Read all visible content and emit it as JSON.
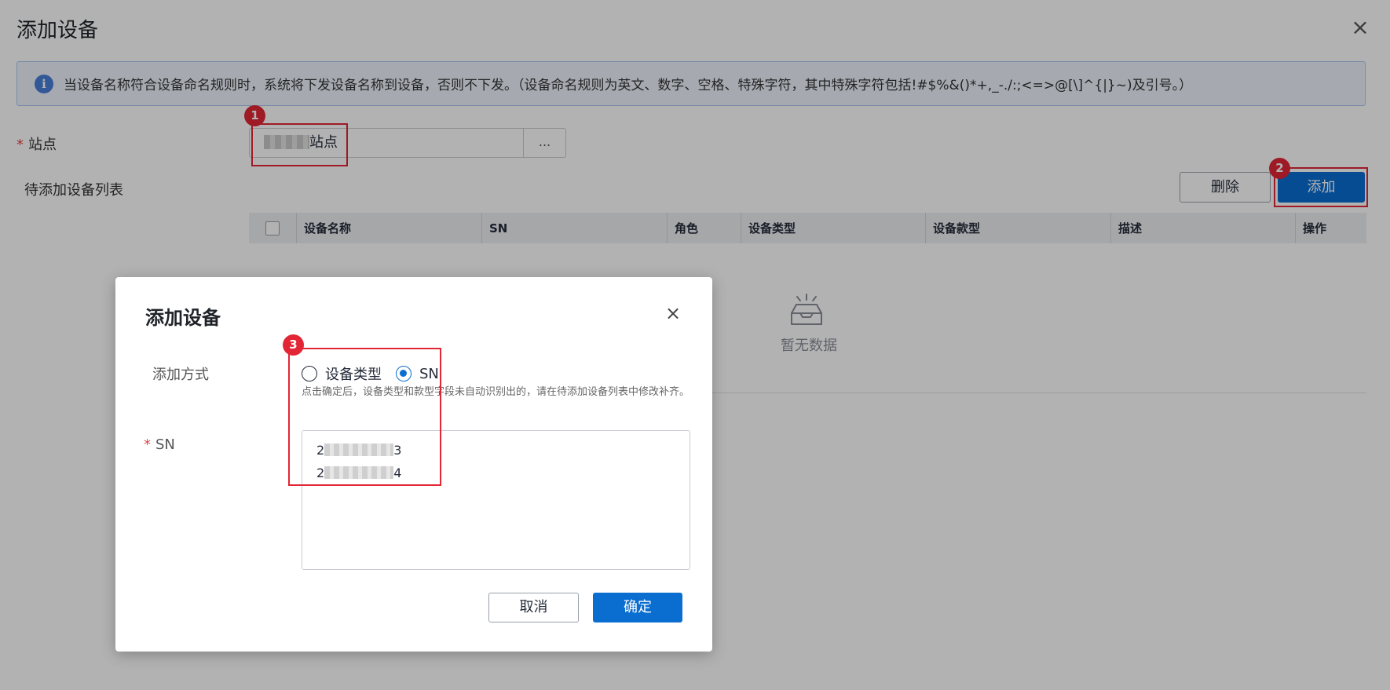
{
  "page": {
    "title": "添加设备",
    "close_icon": "close-icon",
    "info": {
      "icon": "info-icon",
      "icon_glyph": "i",
      "text": "当设备名称符合设备命名规则时，系统将下发设备名称到设备，否则不下发。（设备命名规则为英文、数字、空格、特殊字符，其中特殊字符包括!#$%&()*+,_-./:;<=>@[\\]^{|}~)及引号。）"
    },
    "site": {
      "required_mark": "*",
      "label": "站点",
      "value_suffix": "站点",
      "browse_label": "..."
    },
    "device_list": {
      "label": "待添加设备列表",
      "delete_label": "删除",
      "add_label": "添加",
      "columns": [
        "设备名称",
        "SN",
        "角色",
        "设备类型",
        "设备款型",
        "描述",
        "操作"
      ],
      "empty_text": "暂无数据"
    }
  },
  "dialog": {
    "title": "添加设备",
    "mode_label": "添加方式",
    "mode_options": [
      {
        "label": "设备类型",
        "selected": false
      },
      {
        "label": "SN",
        "selected": true
      }
    ],
    "hint": "点击确定后，设备类型和款型字段未自动识别出的，请在待添加设备列表中修改补齐。",
    "sn_required_mark": "*",
    "sn_label": "SN",
    "sn_lines": [
      {
        "prefix": "2",
        "suffix": "3"
      },
      {
        "prefix": "2",
        "suffix": "4"
      }
    ],
    "cancel_label": "取消",
    "ok_label": "确定"
  },
  "annotations": [
    {
      "number": "1"
    },
    {
      "number": "2"
    },
    {
      "number": "3"
    }
  ],
  "colors": {
    "primary": "#0a6ed1",
    "highlight": "#e32636",
    "overlay": "rgba(0,0,0,0.30)"
  }
}
